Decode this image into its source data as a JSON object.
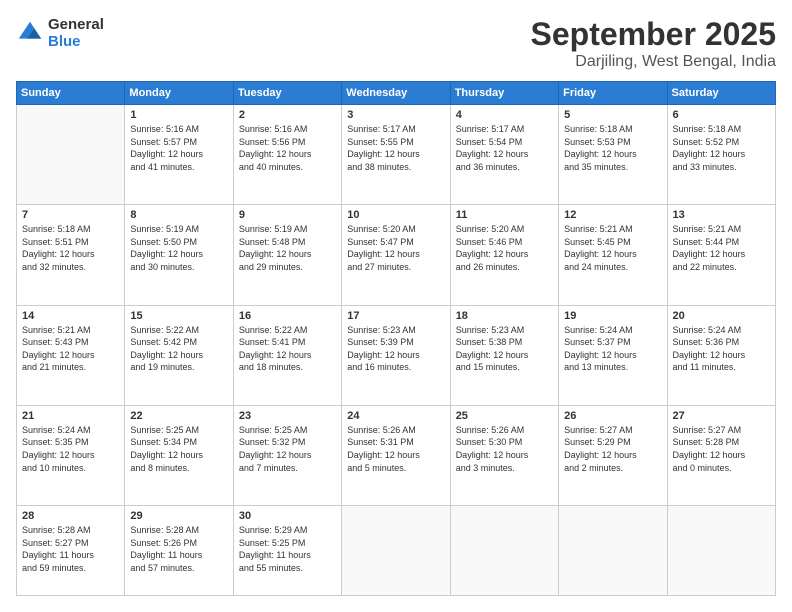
{
  "logo": {
    "text_general": "General",
    "text_blue": "Blue"
  },
  "header": {
    "month": "September 2025",
    "location": "Darjiling, West Bengal, India"
  },
  "weekdays": [
    "Sunday",
    "Monday",
    "Tuesday",
    "Wednesday",
    "Thursday",
    "Friday",
    "Saturday"
  ],
  "weeks": [
    [
      {
        "day": "",
        "info": ""
      },
      {
        "day": "1",
        "info": "Sunrise: 5:16 AM\nSunset: 5:57 PM\nDaylight: 12 hours\nand 41 minutes."
      },
      {
        "day": "2",
        "info": "Sunrise: 5:16 AM\nSunset: 5:56 PM\nDaylight: 12 hours\nand 40 minutes."
      },
      {
        "day": "3",
        "info": "Sunrise: 5:17 AM\nSunset: 5:55 PM\nDaylight: 12 hours\nand 38 minutes."
      },
      {
        "day": "4",
        "info": "Sunrise: 5:17 AM\nSunset: 5:54 PM\nDaylight: 12 hours\nand 36 minutes."
      },
      {
        "day": "5",
        "info": "Sunrise: 5:18 AM\nSunset: 5:53 PM\nDaylight: 12 hours\nand 35 minutes."
      },
      {
        "day": "6",
        "info": "Sunrise: 5:18 AM\nSunset: 5:52 PM\nDaylight: 12 hours\nand 33 minutes."
      }
    ],
    [
      {
        "day": "7",
        "info": "Sunrise: 5:18 AM\nSunset: 5:51 PM\nDaylight: 12 hours\nand 32 minutes."
      },
      {
        "day": "8",
        "info": "Sunrise: 5:19 AM\nSunset: 5:50 PM\nDaylight: 12 hours\nand 30 minutes."
      },
      {
        "day": "9",
        "info": "Sunrise: 5:19 AM\nSunset: 5:48 PM\nDaylight: 12 hours\nand 29 minutes."
      },
      {
        "day": "10",
        "info": "Sunrise: 5:20 AM\nSunset: 5:47 PM\nDaylight: 12 hours\nand 27 minutes."
      },
      {
        "day": "11",
        "info": "Sunrise: 5:20 AM\nSunset: 5:46 PM\nDaylight: 12 hours\nand 26 minutes."
      },
      {
        "day": "12",
        "info": "Sunrise: 5:21 AM\nSunset: 5:45 PM\nDaylight: 12 hours\nand 24 minutes."
      },
      {
        "day": "13",
        "info": "Sunrise: 5:21 AM\nSunset: 5:44 PM\nDaylight: 12 hours\nand 22 minutes."
      }
    ],
    [
      {
        "day": "14",
        "info": "Sunrise: 5:21 AM\nSunset: 5:43 PM\nDaylight: 12 hours\nand 21 minutes."
      },
      {
        "day": "15",
        "info": "Sunrise: 5:22 AM\nSunset: 5:42 PM\nDaylight: 12 hours\nand 19 minutes."
      },
      {
        "day": "16",
        "info": "Sunrise: 5:22 AM\nSunset: 5:41 PM\nDaylight: 12 hours\nand 18 minutes."
      },
      {
        "day": "17",
        "info": "Sunrise: 5:23 AM\nSunset: 5:39 PM\nDaylight: 12 hours\nand 16 minutes."
      },
      {
        "day": "18",
        "info": "Sunrise: 5:23 AM\nSunset: 5:38 PM\nDaylight: 12 hours\nand 15 minutes."
      },
      {
        "day": "19",
        "info": "Sunrise: 5:24 AM\nSunset: 5:37 PM\nDaylight: 12 hours\nand 13 minutes."
      },
      {
        "day": "20",
        "info": "Sunrise: 5:24 AM\nSunset: 5:36 PM\nDaylight: 12 hours\nand 11 minutes."
      }
    ],
    [
      {
        "day": "21",
        "info": "Sunrise: 5:24 AM\nSunset: 5:35 PM\nDaylight: 12 hours\nand 10 minutes."
      },
      {
        "day": "22",
        "info": "Sunrise: 5:25 AM\nSunset: 5:34 PM\nDaylight: 12 hours\nand 8 minutes."
      },
      {
        "day": "23",
        "info": "Sunrise: 5:25 AM\nSunset: 5:32 PM\nDaylight: 12 hours\nand 7 minutes."
      },
      {
        "day": "24",
        "info": "Sunrise: 5:26 AM\nSunset: 5:31 PM\nDaylight: 12 hours\nand 5 minutes."
      },
      {
        "day": "25",
        "info": "Sunrise: 5:26 AM\nSunset: 5:30 PM\nDaylight: 12 hours\nand 3 minutes."
      },
      {
        "day": "26",
        "info": "Sunrise: 5:27 AM\nSunset: 5:29 PM\nDaylight: 12 hours\nand 2 minutes."
      },
      {
        "day": "27",
        "info": "Sunrise: 5:27 AM\nSunset: 5:28 PM\nDaylight: 12 hours\nand 0 minutes."
      }
    ],
    [
      {
        "day": "28",
        "info": "Sunrise: 5:28 AM\nSunset: 5:27 PM\nDaylight: 11 hours\nand 59 minutes."
      },
      {
        "day": "29",
        "info": "Sunrise: 5:28 AM\nSunset: 5:26 PM\nDaylight: 11 hours\nand 57 minutes."
      },
      {
        "day": "30",
        "info": "Sunrise: 5:29 AM\nSunset: 5:25 PM\nDaylight: 11 hours\nand 55 minutes."
      },
      {
        "day": "",
        "info": ""
      },
      {
        "day": "",
        "info": ""
      },
      {
        "day": "",
        "info": ""
      },
      {
        "day": "",
        "info": ""
      }
    ]
  ]
}
